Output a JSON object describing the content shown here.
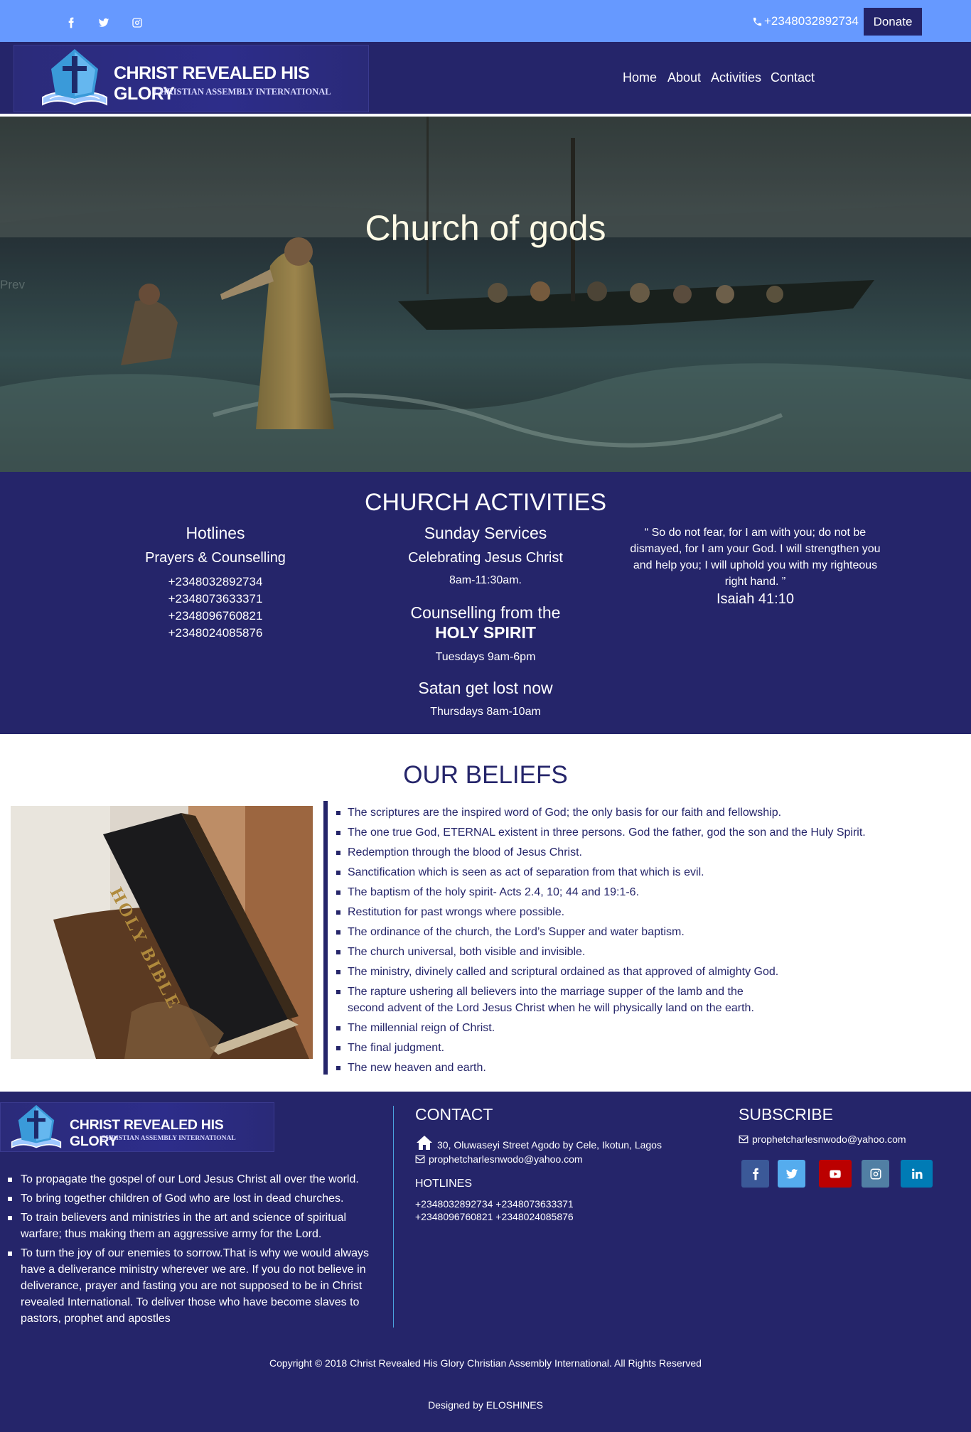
{
  "topbar": {
    "phone": "+2348032892734",
    "donate_label": "Donate",
    "social_icons": [
      "facebook-icon",
      "twitter-icon",
      "instagram-icon"
    ]
  },
  "brand": {
    "title": "CHRIST REVEALED HIS GLORY",
    "subtitle": "CHRISTIAN ASSEMBLY INTERNATIONAL"
  },
  "nav": {
    "items": [
      "Home",
      "About",
      "Activities",
      "Contact"
    ]
  },
  "hero": {
    "title": "Church of gods",
    "prev_label": "Prev"
  },
  "activities": {
    "title": "CHURCH ACTIVITIES",
    "hotlines": {
      "heading": "Hotlines",
      "subheading": "Prayers & Counselling",
      "numbers": [
        "+2348032892734",
        "+2348073633371",
        "+2348096760821",
        "+2348024085876"
      ]
    },
    "services": {
      "heading": "Sunday Services",
      "subheading": "Celebrating Jesus Christ",
      "time": "8am-11:30am.",
      "counselling_heading": "Counselling from the",
      "counselling_strong": "HOLY SPIRIT",
      "counselling_time": "Tuesdays 9am-6pm",
      "satan_heading": "Satan get lost now",
      "satan_time": "Thursdays 8am-10am"
    },
    "verse": {
      "text": "“ So do not fear, for I am with you; do not be dismayed, for I am your God. I will strengthen you and help you; I will uphold you with my righteous right hand. ”",
      "reference": "Isaiah 41:10"
    }
  },
  "beliefs": {
    "title": "OUR BELIEFS",
    "image_label": "HOLY BIBLE",
    "items": [
      "The scriptures are the inspired word of God; the only basis for our faith and fellowship.",
      "The one true God, ETERNAL existent in three persons. God the father, god the son and the Huly Spirit.",
      "Redemption through the blood of Jesus Christ.",
      "Sanctification which is seen as act of separation from that which is evil.",
      "The baptism of the holy spirit- Acts 2.4, 10; 44 and 19:1-6.",
      "Restitution for past wrongs where possible.",
      "The ordinance of the church, the Lord’s Supper and water baptism.",
      "The church universal, both visible and invisible.",
      "The ministry, divinely called and scriptural ordained as that approved of almighty God.",
      "The rapture ushering all believers into the marriage supper of the lamb and the second advent of the Lord Jesus Christ when he will physically land on the earth.",
      "The millennial reign of Christ.",
      "The final judgment.",
      "The new heaven and earth."
    ]
  },
  "footer": {
    "mission": [
      "To propagate the gospel of our Lord Jesus Christ all over the world.",
      "To bring together children of God who are lost in dead churches.",
      "To train believers and ministries in the art and science of spiritual warfare; thus making them an aggressive army for the Lord.",
      "To turn the joy of our enemies to sorrow.That is why we would always have a deliverance ministry wherever we are. If you do not believe in deliverance, prayer and fasting you are not supposed to be in Christ revealed International. To deliver those who have become slaves to pastors, prophet and apostles"
    ],
    "contact": {
      "title": "CONTACT",
      "address": "30, Oluwaseyi Street Agodo by Cele, Ikotun, Lagos",
      "email": "prophetcharlesnwodo@yahoo.com",
      "hotlines_title": "HOTLINES",
      "hotlines_line1": "+2348032892734 +2348073633371",
      "hotlines_line2": "+2348096760821 +2348024085876"
    },
    "subscribe": {
      "title": "SUBSCRIBE",
      "email": "prophetcharlesnwodo@yahoo.com",
      "buttons": [
        {
          "icon": "facebook-icon",
          "color": "#3b5998"
        },
        {
          "icon": "twitter-icon",
          "color": "#55acee"
        },
        {
          "icon": "youtube-icon",
          "color": "#bb0000"
        },
        {
          "icon": "instagram-icon",
          "color": "#517fa4"
        },
        {
          "icon": "linkedin-icon",
          "color": "#007bb5"
        }
      ]
    },
    "copyright": "Copyright © 2018 Christ Revealed His Glory Christian Assembly International. All Rights Reserved",
    "designed_by": "Designed by ELOSHINES"
  },
  "colors": {
    "topbar": "#6699ff",
    "primary": "#25256a",
    "accent_line": "#4aa3df"
  }
}
